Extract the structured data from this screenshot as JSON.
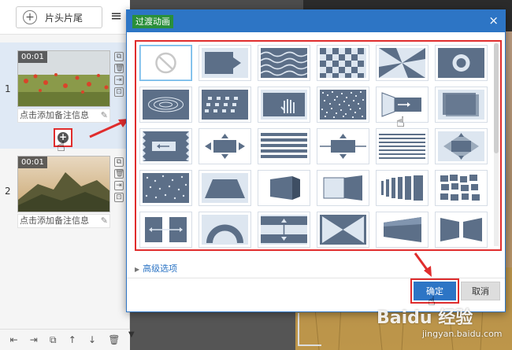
{
  "left_panel": {
    "head_tail_label": "片头片尾",
    "clips": [
      {
        "number": "1",
        "time": "00:01",
        "note": "点击添加备注信息"
      },
      {
        "number": "2",
        "time": "00:01",
        "note": "点击添加备注信息"
      }
    ]
  },
  "dialog": {
    "title": "过渡动画",
    "close": "×",
    "advanced_label": "高级选项",
    "ok_label": "确定",
    "cancel_label": "取消"
  },
  "watermark": {
    "brand": "Baidu 经验",
    "url": "jingyan.baidu.com"
  },
  "colors": {
    "accent": "#2d75c5",
    "highlight": "#e02d2d",
    "tile": "#5c6f88"
  }
}
